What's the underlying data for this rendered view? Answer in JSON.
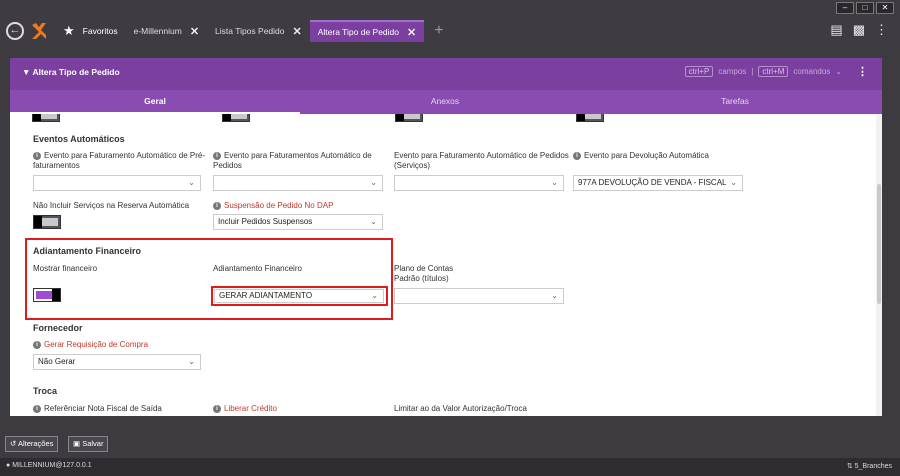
{
  "titlebar": {
    "window_controls": [
      "minimize",
      "maximize",
      "close"
    ],
    "tabs": [
      {
        "label": "Favoritos"
      },
      {
        "label": "e-Millennium"
      },
      {
        "label": "Lista Tipos Pedido"
      },
      {
        "label": "Altera Tipo de Pedido"
      }
    ]
  },
  "header": {
    "title": "Altera Tipo de Pedido",
    "shortcut_fields_key": "ctrl+P",
    "shortcut_fields_label": "campos",
    "separator": "|",
    "shortcut_commands_key": "ctrl+M",
    "shortcut_commands_label": "comandos"
  },
  "subtabs": [
    "Geral",
    "Anexos",
    "Tarefas"
  ],
  "eventos": {
    "title": "Eventos Automáticos",
    "f1_label": "Evento para Faturamento Automático de Pré-faturamentos",
    "f2_label": "Evento para Faturamentos Automático de Pedidos",
    "f3_label": "Evento para Faturamento Automático de Pedidos (Serviços)",
    "f4_label": "Evento para Devolução Automática",
    "f4_value": "977A DEVOLUÇÃO DE VENDA - FISCAL",
    "reserva_label": "Não Incluir Serviços na Reserva Automática",
    "suspensao_label": "Suspensão de Pedido No DAP",
    "suspensao_value": "Incluir Pedidos Suspensos"
  },
  "adiantamento": {
    "title": "Adiantamento Financeiro",
    "mostrar_label": "Mostrar financeiro",
    "adiant_label": "Adiantamento Financeiro",
    "adiant_value": "GERAR ADIANTAMENTO",
    "plano_label_1": "Plano de Contas",
    "plano_label_2": "Padrão (títulos)"
  },
  "fornecedor": {
    "title": "Fornecedor",
    "req_label": "Gerar Requisição de Compra",
    "req_value": "Não Gerar"
  },
  "troca": {
    "title": "Troca",
    "nf_label": "Referênciar Nota Fiscal de Saída",
    "credito_label": "Liberar Crédito",
    "limitar_label": "Limitar ao da Valor Autorização/Troca"
  },
  "bottom": {
    "alteracoes": "Alterações",
    "salvar": "Salvar"
  },
  "status": {
    "connection": "MILLENNIUM@127.0.0.1",
    "branches": "5_Branches"
  },
  "colors": {
    "accent": "#7b3fa0",
    "highlight": "#e01b1b"
  }
}
